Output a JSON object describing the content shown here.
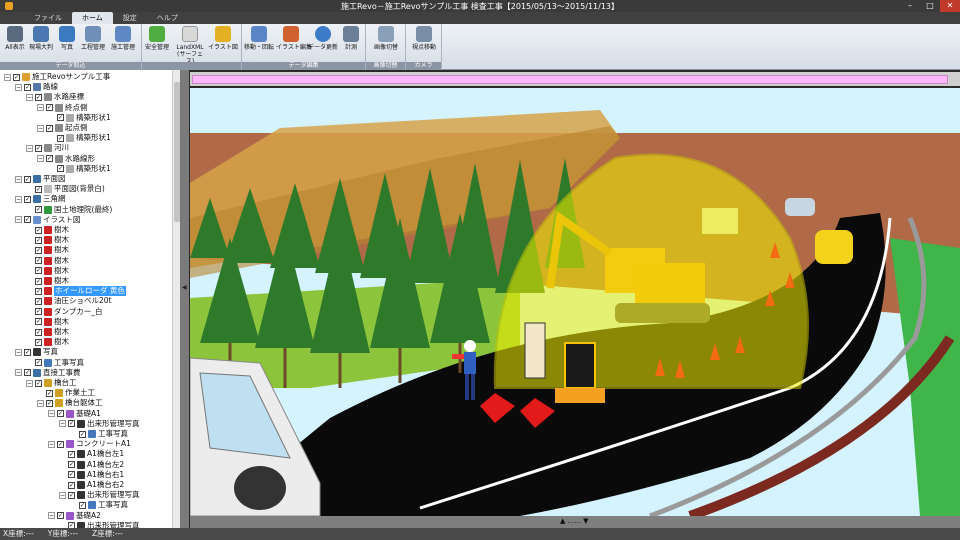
{
  "window": {
    "title": "施工Revo－施工Revoサンプル工事 検査工事【2015/05/13～2015/11/13】",
    "controls": [
      "–",
      "□",
      "✕"
    ]
  },
  "menu_tabs": [
    "ファイル",
    "ホーム",
    "設定",
    "ヘルプ"
  ],
  "ribbon": {
    "groups": [
      {
        "label": "データ取込",
        "buttons": [
          "All表示",
          "現場大判",
          "写真",
          "工程管理",
          "施工管理"
        ]
      },
      {
        "label": "",
        "buttons": [
          "安全管理",
          "LandXML\n(サーフェス)",
          "イラスト図"
        ]
      },
      {
        "label": "データ編集",
        "buttons": [
          "移動・回転",
          "イラスト編集",
          "データ更新",
          "計測"
        ]
      },
      {
        "label": "画像切替",
        "buttons": [
          "画像切替"
        ]
      },
      {
        "label": "カメラ",
        "buttons": [
          "視点移動"
        ]
      }
    ]
  },
  "tree": [
    {
      "indent": 0,
      "exp": "−",
      "text": "施工Revoサンプル工事",
      "icon": "#e0a030"
    },
    {
      "indent": 1,
      "exp": "−",
      "text": "路線",
      "icon": "#5577aa"
    },
    {
      "indent": 2,
      "exp": "−",
      "text": "水路座標",
      "icon": "#888888"
    },
    {
      "indent": 3,
      "exp": "−",
      "text": "終点側",
      "icon": "#888888"
    },
    {
      "indent": 4,
      "exp": "",
      "text": "構築形状1",
      "icon": "#aaaaaa"
    },
    {
      "indent": 3,
      "exp": "−",
      "text": "起点側",
      "icon": "#888888"
    },
    {
      "indent": 4,
      "exp": "",
      "text": "構築形状1",
      "icon": "#aaaaaa"
    },
    {
      "indent": 2,
      "exp": "−",
      "text": "河川",
      "icon": "#888888"
    },
    {
      "indent": 3,
      "exp": "−",
      "text": "水路線形",
      "icon": "#888888"
    },
    {
      "indent": 4,
      "exp": "",
      "text": "構築形状1",
      "icon": "#aaaaaa"
    },
    {
      "indent": 1,
      "exp": "−",
      "text": "平面図",
      "icon": "#3a6ea5"
    },
    {
      "indent": 2,
      "exp": "",
      "text": "平面図(背景白)",
      "icon": "#bbbbbb"
    },
    {
      "indent": 1,
      "exp": "−",
      "text": "三角網",
      "icon": "#3a6ea5"
    },
    {
      "indent": 2,
      "exp": "",
      "text": "国土地理院(最終)",
      "icon": "#2f9a3a"
    },
    {
      "indent": 1,
      "exp": "−",
      "text": "イラスト図",
      "icon": "#6a8fd0"
    },
    {
      "indent": 2,
      "exp": "",
      "text": "樹木",
      "icon": "#cc2222"
    },
    {
      "indent": 2,
      "exp": "",
      "text": "樹木",
      "icon": "#cc2222"
    },
    {
      "indent": 2,
      "exp": "",
      "text": "樹木",
      "icon": "#cc2222"
    },
    {
      "indent": 2,
      "exp": "",
      "text": "樹木",
      "icon": "#cc2222"
    },
    {
      "indent": 2,
      "exp": "",
      "text": "樹木",
      "icon": "#cc2222"
    },
    {
      "indent": 2,
      "exp": "",
      "text": "樹木",
      "icon": "#cc2222"
    },
    {
      "indent": 2,
      "exp": "",
      "text": "ホイールローダ 黄色",
      "icon": "#cc2222",
      "selected": true
    },
    {
      "indent": 2,
      "exp": "",
      "text": "油圧ショベル20t",
      "icon": "#cc2222"
    },
    {
      "indent": 2,
      "exp": "",
      "text": "ダンプカー_白",
      "icon": "#cc2222"
    },
    {
      "indent": 2,
      "exp": "",
      "text": "樹木",
      "icon": "#cc2222"
    },
    {
      "indent": 2,
      "exp": "",
      "text": "樹木",
      "icon": "#cc2222"
    },
    {
      "indent": 2,
      "exp": "",
      "text": "樹木",
      "icon": "#cc2222"
    },
    {
      "indent": 1,
      "exp": "−",
      "text": "写真",
      "icon": "#333333"
    },
    {
      "indent": 2,
      "exp": "",
      "text": "工事写真",
      "icon": "#4477bb"
    },
    {
      "indent": 1,
      "exp": "−",
      "text": "直接工事費",
      "icon": "#3a6ea5"
    },
    {
      "indent": 2,
      "exp": "−",
      "text": "橋台工",
      "icon": "#d0a020"
    },
    {
      "indent": 3,
      "exp": "",
      "text": "作業土工",
      "icon": "#d0a020"
    },
    {
      "indent": 3,
      "exp": "−",
      "text": "橋台躯体工",
      "icon": "#d0a020"
    },
    {
      "indent": 4,
      "exp": "−",
      "text": "基礎A1",
      "icon": "#9955cc"
    },
    {
      "indent": 5,
      "exp": "−",
      "text": "出来形管理写真",
      "icon": "#333333"
    },
    {
      "indent": 6,
      "exp": "",
      "text": "工事写真",
      "icon": "#4477bb"
    },
    {
      "indent": 4,
      "exp": "−",
      "text": "コンクリートA1",
      "icon": "#9955cc"
    },
    {
      "indent": 5,
      "exp": "",
      "text": "A1橋台左1",
      "icon": "#333333"
    },
    {
      "indent": 5,
      "exp": "",
      "text": "A1橋台左2",
      "icon": "#333333"
    },
    {
      "indent": 5,
      "exp": "",
      "text": "A1橋台右1",
      "icon": "#333333"
    },
    {
      "indent": 5,
      "exp": "",
      "text": "A1橋台右2",
      "icon": "#333333"
    },
    {
      "indent": 5,
      "exp": "−",
      "text": "出来形管理写真",
      "icon": "#333333"
    },
    {
      "indent": 6,
      "exp": "",
      "text": "工事写真",
      "icon": "#4477bb"
    },
    {
      "indent": 4,
      "exp": "−",
      "text": "基礎A2",
      "icon": "#9955cc"
    },
    {
      "indent": 5,
      "exp": "",
      "text": "出来形管理写真",
      "icon": "#333333"
    }
  ],
  "status": {
    "x": "X座標:---",
    "y": "Y座標:---",
    "z": "Z座標:---"
  },
  "colors": {
    "ribbon_bg": "#dfe6ee",
    "selected": "#3399ff",
    "pink_bar": "#ffb6ff",
    "safety_dome": "#f0f000"
  }
}
